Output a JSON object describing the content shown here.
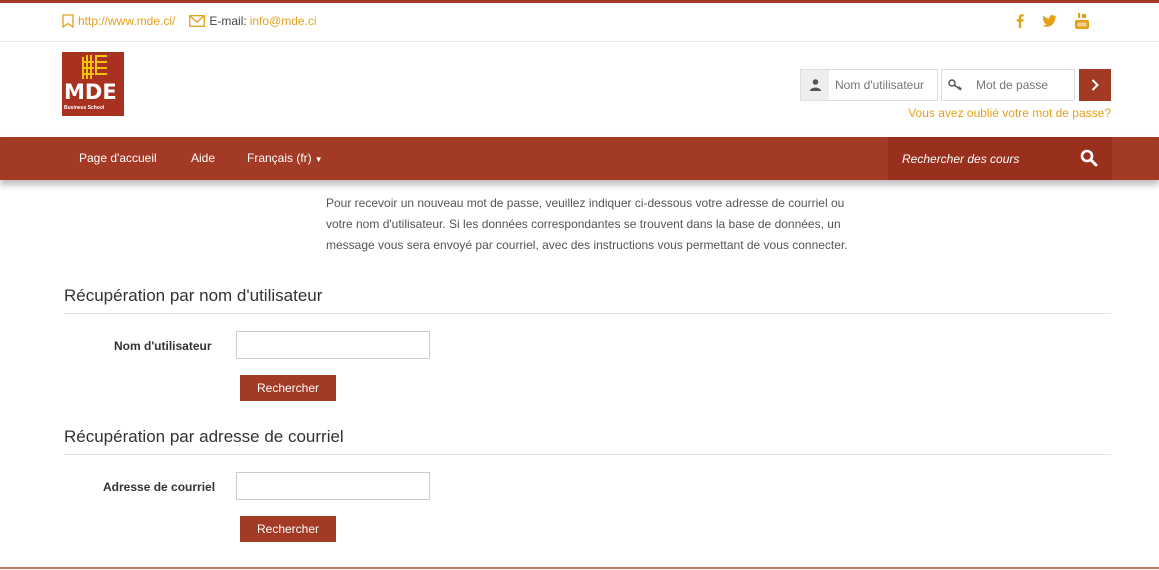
{
  "topbar": {
    "website_url": "http://www.mde.ci/",
    "email_label": "E-mail:",
    "email_value": "info@mde.ci",
    "social_icons": [
      "facebook-icon",
      "twitter-icon",
      "youtube-icon"
    ]
  },
  "logo": {
    "text": "MDE",
    "subtext": "Business School"
  },
  "login": {
    "username_placeholder": "Nom d'utilisateur",
    "password_placeholder": "Mot de passe",
    "forgot_link": "Vous avez oublié votre mot de passe?"
  },
  "nav": {
    "items": [
      "Page d'accueil",
      "Aide",
      "Français (fr)"
    ],
    "search_placeholder": "Rechercher des cours"
  },
  "main": {
    "intro": "Pour recevoir un nouveau mot de passe, veuillez indiquer ci-dessous votre adresse de courriel ou votre nom d'utilisateur. Si les données correspondantes se trouvent dans la base de données, un message vous sera envoyé par courriel, avec des instructions vous permettant de vous connecter.",
    "username_section": {
      "title": "Récupération par nom d'utilisateur",
      "field_label": "Nom d'utilisateur",
      "field_value": "",
      "button": "Rechercher"
    },
    "email_section": {
      "title": "Récupération par adresse de courriel",
      "field_label": "Adresse de courriel",
      "field_value": "",
      "button": "Rechercher"
    }
  },
  "colors": {
    "brand_red": "#a23a26",
    "accent_gold": "#e3a01b"
  }
}
